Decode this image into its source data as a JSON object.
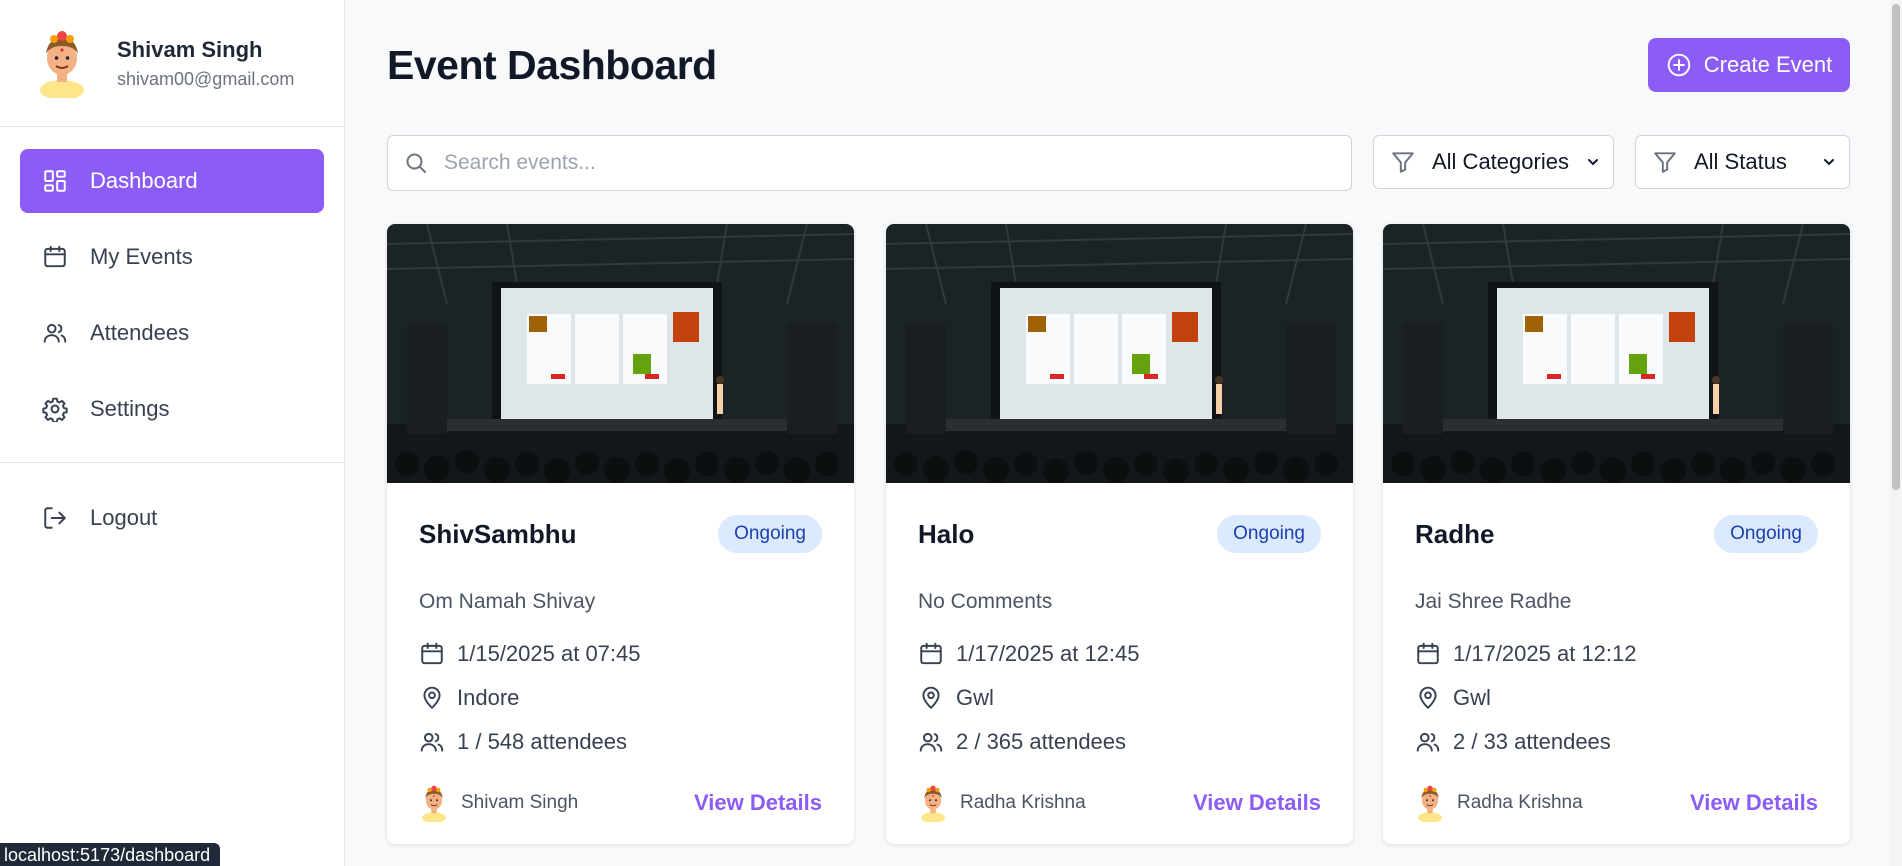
{
  "user": {
    "name": "Shivam Singh",
    "email": "shivam00@gmail.com"
  },
  "sidebar": {
    "items": [
      {
        "label": "Dashboard",
        "icon": "layout-grid-icon",
        "active": true
      },
      {
        "label": "My Events",
        "icon": "calendar-icon",
        "active": false
      },
      {
        "label": "Attendees",
        "icon": "users-icon",
        "active": false
      },
      {
        "label": "Settings",
        "icon": "gear-icon",
        "active": false
      }
    ],
    "logout_label": "Logout"
  },
  "header": {
    "title": "Event Dashboard",
    "create_label": "Create Event"
  },
  "filters": {
    "search_placeholder": "Search events...",
    "category": "All Categories",
    "status": "All Status"
  },
  "events": [
    {
      "title": "ShivSambhu",
      "status": "Ongoing",
      "description": "Om Namah Shivay",
      "datetime": "1/15/2025 at 07:45",
      "location": "Indore",
      "attendees": "1 / 548 attendees",
      "organizer": "Shivam Singh",
      "link_label": "View Details"
    },
    {
      "title": "Halo",
      "status": "Ongoing",
      "description": "No Comments",
      "datetime": "1/17/2025 at 12:45",
      "location": "Gwl",
      "attendees": "2 / 365 attendees",
      "organizer": "Radha Krishna",
      "link_label": "View Details"
    },
    {
      "title": "Radhe",
      "status": "Ongoing",
      "description": "Jai Shree Radhe",
      "datetime": "1/17/2025 at 12:12",
      "location": "Gwl",
      "attendees": "2 / 33 attendees",
      "organizer": "Radha Krishna",
      "link_label": "View Details"
    }
  ],
  "status_bar": {
    "url": "localhost:5173/dashboard"
  },
  "colors": {
    "accent": "#8b5cf6",
    "badge_bg": "#dbeafe",
    "badge_text": "#1e40af"
  }
}
